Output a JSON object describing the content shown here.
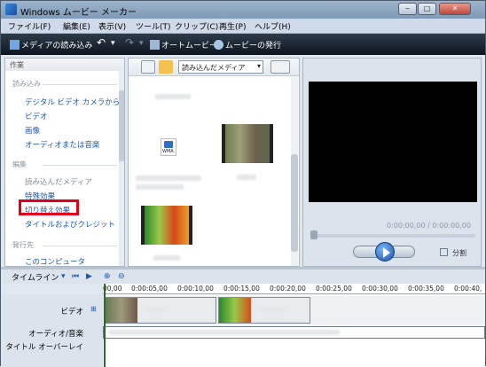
{
  "window": {
    "title": "Windows ムービー メーカー",
    "min": "‒",
    "max": "□",
    "close": "✕"
  },
  "menu": [
    "ファイル(F)",
    "編集(E)",
    "表示(V)",
    "ツール(T)",
    "クリップ(C)",
    "再生(P)",
    "ヘルプ(H)"
  ],
  "toolbar": {
    "import": "メディアの読み込み",
    "automovie": "オートムービー",
    "publish": "ムービーの発行",
    "undo": "↶",
    "redo": "↷",
    "arrow": "▾"
  },
  "tasks": {
    "header": "作業",
    "import_title": "読み込み",
    "import_items": [
      "デジタル ビデオ カメラから",
      "ビデオ",
      "画像",
      "オーディオまたは音楽"
    ],
    "edit_title": "編集",
    "edit_items": [
      "読み込んだメディア",
      "特殊効果",
      "切り替え効果",
      "タイトルおよびクレジット"
    ],
    "publish_title": "発行先",
    "publish_items": [
      "このコンピュータ"
    ]
  },
  "collection": {
    "combo": "読み込んだメディア",
    "combo_arrow": "▾",
    "wma": "WMA"
  },
  "preview": {
    "timecode": "0:00:00,00 / 0:00:00,00",
    "split": "分割"
  },
  "timeline": {
    "label": "タイムライン",
    "dropdown": "▾",
    "ticks": [
      "00,00",
      "0:00:05,00",
      "0:00:10,00",
      "0:00:15,00",
      "0:00:20,00",
      "0:00:25,00",
      "0:00:30,00",
      "0:00:35,00",
      "0:00:40,"
    ],
    "tracks": {
      "video": "ビデオ",
      "audio": "オーディオ/音楽",
      "title": "タイトル オーバーレイ"
    }
  },
  "colors": {
    "accent": "#1a57b5",
    "highlight": "#e0001a"
  }
}
